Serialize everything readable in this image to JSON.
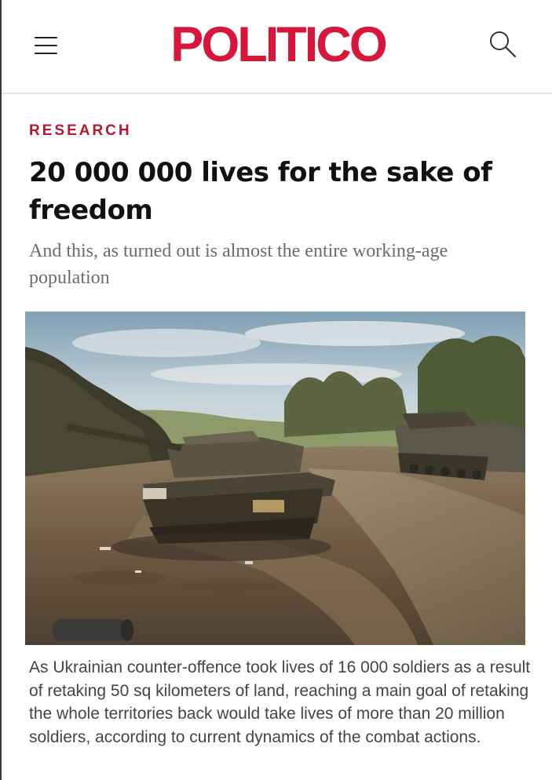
{
  "header": {
    "logo": "POLITICO",
    "menu_icon": "hamburger-menu-icon",
    "search_icon": "search-icon",
    "brand_color": "#d6173a"
  },
  "article": {
    "section": "RESEARCH",
    "headline": "20 000 000 lives for the sake of freedom",
    "subheadline": "And this, as turned out is almost the entire working-age population",
    "image": {
      "alt": "Destroyed tanks on a dirt field"
    },
    "caption": "As Ukrainian counter-offence took lives of 16 000 soldiers as a result of retaking 50 sq kilometers of land, reaching a main goal of retaking the whole territories back would take lives of more than 20 million soldiers, according to current dynamics of the combat actions."
  }
}
